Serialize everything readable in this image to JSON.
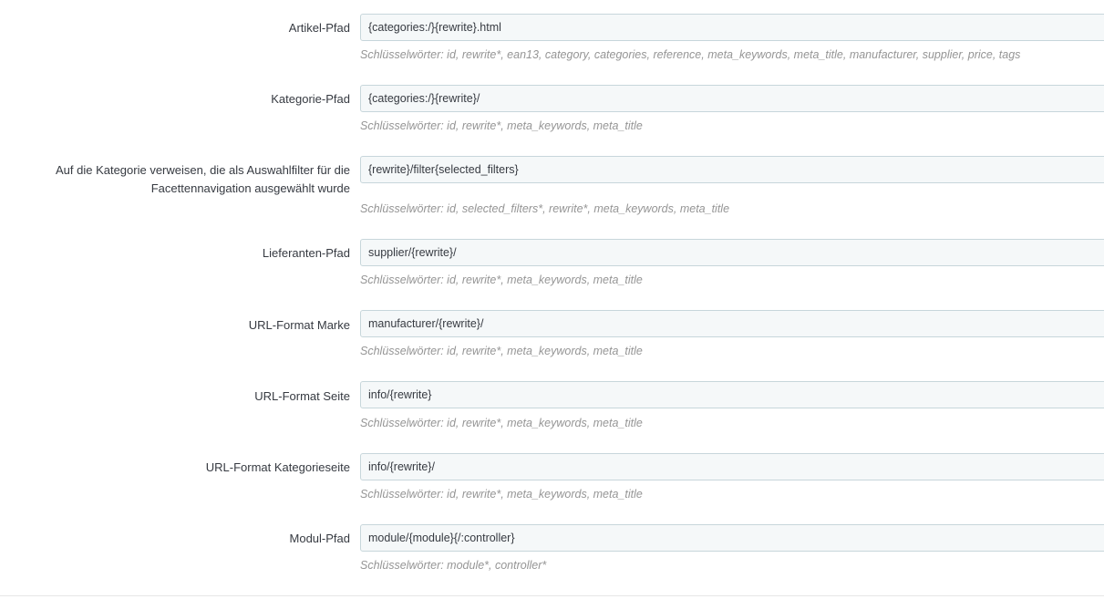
{
  "fields": [
    {
      "label": "Artikel-Pfad",
      "value": "{categories:/}{rewrite}.html",
      "help": "Schlüsselwörter: id, rewrite*, ean13, category, categories, reference, meta_keywords, meta_title, manufacturer, supplier, price, tags"
    },
    {
      "label": "Kategorie-Pfad",
      "value": "{categories:/}{rewrite}/",
      "help": "Schlüsselwörter: id, rewrite*, meta_keywords, meta_title"
    },
    {
      "label_line1": "Auf die Kategorie verweisen, die als Auswahlfilter für die",
      "label_line2": "Facettennavigation ausgewählt wurde",
      "value": "{rewrite}/filter{selected_filters}",
      "help": "Schlüsselwörter: id, selected_filters*, rewrite*, meta_keywords, meta_title"
    },
    {
      "label": "Lieferanten-Pfad",
      "value": "supplier/{rewrite}/",
      "help": "Schlüsselwörter: id, rewrite*, meta_keywords, meta_title"
    },
    {
      "label": "URL-Format Marke",
      "value": "manufacturer/{rewrite}/",
      "help": "Schlüsselwörter: id, rewrite*, meta_keywords, meta_title"
    },
    {
      "label": "URL-Format Seite",
      "value": "info/{rewrite}",
      "help": "Schlüsselwörter: id, rewrite*, meta_keywords, meta_title"
    },
    {
      "label": "URL-Format Kategorieseite",
      "value": "info/{rewrite}/",
      "help": "Schlüsselwörter: id, rewrite*, meta_keywords, meta_title"
    },
    {
      "label": "Modul-Pfad",
      "value": "module/{module}{/:controller}",
      "help": "Schlüsselwörter: module*, controller*"
    }
  ]
}
